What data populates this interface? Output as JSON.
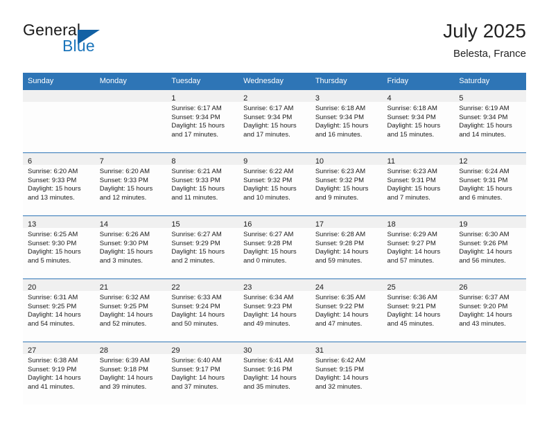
{
  "brand": {
    "word_one": "General",
    "word_two": "Blue",
    "logo_icon": "triangle-logo-icon"
  },
  "header": {
    "title": "July 2025",
    "location": "Belesta, France"
  },
  "colors": {
    "header_blue": "#2e75b6",
    "brand_blue": "#1b75bb",
    "daynum_band": "#f0f0f0",
    "text": "#1a1a1a"
  },
  "weekday_headers": [
    "Sunday",
    "Monday",
    "Tuesday",
    "Wednesday",
    "Thursday",
    "Friday",
    "Saturday"
  ],
  "weeks": [
    [
      {
        "day": "",
        "lines": []
      },
      {
        "day": "",
        "lines": []
      },
      {
        "day": "1",
        "lines": [
          "Sunrise: 6:17 AM",
          "Sunset: 9:34 PM",
          "Daylight: 15 hours",
          "and 17 minutes."
        ]
      },
      {
        "day": "2",
        "lines": [
          "Sunrise: 6:17 AM",
          "Sunset: 9:34 PM",
          "Daylight: 15 hours",
          "and 17 minutes."
        ]
      },
      {
        "day": "3",
        "lines": [
          "Sunrise: 6:18 AM",
          "Sunset: 9:34 PM",
          "Daylight: 15 hours",
          "and 16 minutes."
        ]
      },
      {
        "day": "4",
        "lines": [
          "Sunrise: 6:18 AM",
          "Sunset: 9:34 PM",
          "Daylight: 15 hours",
          "and 15 minutes."
        ]
      },
      {
        "day": "5",
        "lines": [
          "Sunrise: 6:19 AM",
          "Sunset: 9:34 PM",
          "Daylight: 15 hours",
          "and 14 minutes."
        ]
      }
    ],
    [
      {
        "day": "6",
        "lines": [
          "Sunrise: 6:20 AM",
          "Sunset: 9:33 PM",
          "Daylight: 15 hours",
          "and 13 minutes."
        ]
      },
      {
        "day": "7",
        "lines": [
          "Sunrise: 6:20 AM",
          "Sunset: 9:33 PM",
          "Daylight: 15 hours",
          "and 12 minutes."
        ]
      },
      {
        "day": "8",
        "lines": [
          "Sunrise: 6:21 AM",
          "Sunset: 9:33 PM",
          "Daylight: 15 hours",
          "and 11 minutes."
        ]
      },
      {
        "day": "9",
        "lines": [
          "Sunrise: 6:22 AM",
          "Sunset: 9:32 PM",
          "Daylight: 15 hours",
          "and 10 minutes."
        ]
      },
      {
        "day": "10",
        "lines": [
          "Sunrise: 6:23 AM",
          "Sunset: 9:32 PM",
          "Daylight: 15 hours",
          "and 9 minutes."
        ]
      },
      {
        "day": "11",
        "lines": [
          "Sunrise: 6:23 AM",
          "Sunset: 9:31 PM",
          "Daylight: 15 hours",
          "and 7 minutes."
        ]
      },
      {
        "day": "12",
        "lines": [
          "Sunrise: 6:24 AM",
          "Sunset: 9:31 PM",
          "Daylight: 15 hours",
          "and 6 minutes."
        ]
      }
    ],
    [
      {
        "day": "13",
        "lines": [
          "Sunrise: 6:25 AM",
          "Sunset: 9:30 PM",
          "Daylight: 15 hours",
          "and 5 minutes."
        ]
      },
      {
        "day": "14",
        "lines": [
          "Sunrise: 6:26 AM",
          "Sunset: 9:30 PM",
          "Daylight: 15 hours",
          "and 3 minutes."
        ]
      },
      {
        "day": "15",
        "lines": [
          "Sunrise: 6:27 AM",
          "Sunset: 9:29 PM",
          "Daylight: 15 hours",
          "and 2 minutes."
        ]
      },
      {
        "day": "16",
        "lines": [
          "Sunrise: 6:27 AM",
          "Sunset: 9:28 PM",
          "Daylight: 15 hours",
          "and 0 minutes."
        ]
      },
      {
        "day": "17",
        "lines": [
          "Sunrise: 6:28 AM",
          "Sunset: 9:28 PM",
          "Daylight: 14 hours",
          "and 59 minutes."
        ]
      },
      {
        "day": "18",
        "lines": [
          "Sunrise: 6:29 AM",
          "Sunset: 9:27 PM",
          "Daylight: 14 hours",
          "and 57 minutes."
        ]
      },
      {
        "day": "19",
        "lines": [
          "Sunrise: 6:30 AM",
          "Sunset: 9:26 PM",
          "Daylight: 14 hours",
          "and 56 minutes."
        ]
      }
    ],
    [
      {
        "day": "20",
        "lines": [
          "Sunrise: 6:31 AM",
          "Sunset: 9:25 PM",
          "Daylight: 14 hours",
          "and 54 minutes."
        ]
      },
      {
        "day": "21",
        "lines": [
          "Sunrise: 6:32 AM",
          "Sunset: 9:25 PM",
          "Daylight: 14 hours",
          "and 52 minutes."
        ]
      },
      {
        "day": "22",
        "lines": [
          "Sunrise: 6:33 AM",
          "Sunset: 9:24 PM",
          "Daylight: 14 hours",
          "and 50 minutes."
        ]
      },
      {
        "day": "23",
        "lines": [
          "Sunrise: 6:34 AM",
          "Sunset: 9:23 PM",
          "Daylight: 14 hours",
          "and 49 minutes."
        ]
      },
      {
        "day": "24",
        "lines": [
          "Sunrise: 6:35 AM",
          "Sunset: 9:22 PM",
          "Daylight: 14 hours",
          "and 47 minutes."
        ]
      },
      {
        "day": "25",
        "lines": [
          "Sunrise: 6:36 AM",
          "Sunset: 9:21 PM",
          "Daylight: 14 hours",
          "and 45 minutes."
        ]
      },
      {
        "day": "26",
        "lines": [
          "Sunrise: 6:37 AM",
          "Sunset: 9:20 PM",
          "Daylight: 14 hours",
          "and 43 minutes."
        ]
      }
    ],
    [
      {
        "day": "27",
        "lines": [
          "Sunrise: 6:38 AM",
          "Sunset: 9:19 PM",
          "Daylight: 14 hours",
          "and 41 minutes."
        ]
      },
      {
        "day": "28",
        "lines": [
          "Sunrise: 6:39 AM",
          "Sunset: 9:18 PM",
          "Daylight: 14 hours",
          "and 39 minutes."
        ]
      },
      {
        "day": "29",
        "lines": [
          "Sunrise: 6:40 AM",
          "Sunset: 9:17 PM",
          "Daylight: 14 hours",
          "and 37 minutes."
        ]
      },
      {
        "day": "30",
        "lines": [
          "Sunrise: 6:41 AM",
          "Sunset: 9:16 PM",
          "Daylight: 14 hours",
          "and 35 minutes."
        ]
      },
      {
        "day": "31",
        "lines": [
          "Sunrise: 6:42 AM",
          "Sunset: 9:15 PM",
          "Daylight: 14 hours",
          "and 32 minutes."
        ]
      },
      {
        "day": "",
        "lines": []
      },
      {
        "day": "",
        "lines": []
      }
    ]
  ]
}
